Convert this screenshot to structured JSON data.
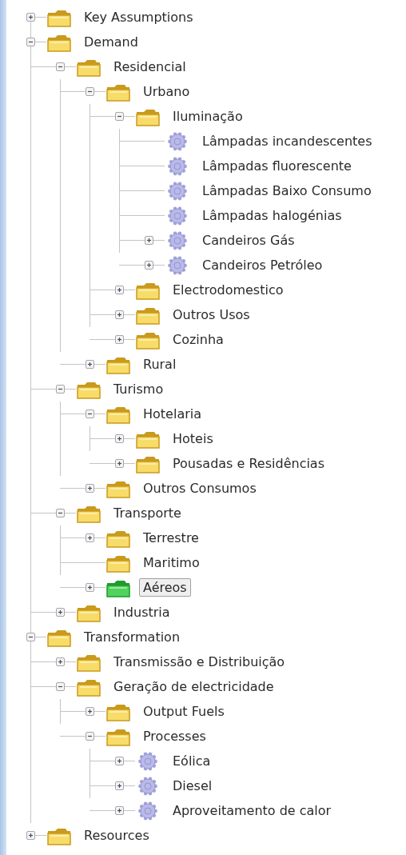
{
  "tree": [
    {
      "label": "Key Assumptions",
      "kind": "folder",
      "expanded": false,
      "selected": false
    },
    {
      "label": "Demand",
      "kind": "folder",
      "expanded": true,
      "selected": false,
      "children": [
        {
          "label": "Residencial",
          "kind": "folder",
          "expanded": true,
          "selected": false,
          "children": [
            {
              "label": "Urbano",
              "kind": "folder",
              "expanded": true,
              "selected": false,
              "children": [
                {
                  "label": "Iluminação",
                  "kind": "folder",
                  "expanded": true,
                  "selected": false,
                  "children": [
                    {
                      "label": "Lâmpadas incandescentes",
                      "kind": "gear",
                      "selected": false
                    },
                    {
                      "label": "Lâmpadas fluorescente",
                      "kind": "gear",
                      "selected": false
                    },
                    {
                      "label": "Lâmpadas Baixo Consumo",
                      "kind": "gear",
                      "selected": false
                    },
                    {
                      "label": "Lâmpadas halogénias",
                      "kind": "gear",
                      "selected": false
                    },
                    {
                      "label": "Candeiros Gás",
                      "kind": "gear",
                      "expanded": false,
                      "selected": false
                    },
                    {
                      "label": "Candeiros Petróleo",
                      "kind": "gear",
                      "expanded": false,
                      "selected": false
                    }
                  ]
                },
                {
                  "label": "Electrodomestico",
                  "kind": "folder",
                  "expanded": false,
                  "selected": false
                },
                {
                  "label": "Outros Usos",
                  "kind": "folder",
                  "expanded": false,
                  "selected": false
                },
                {
                  "label": "Cozinha",
                  "kind": "folder",
                  "expanded": false,
                  "selected": false
                }
              ]
            },
            {
              "label": "Rural",
              "kind": "folder",
              "expanded": false,
              "selected": false
            }
          ]
        },
        {
          "label": "Turismo",
          "kind": "folder",
          "expanded": true,
          "selected": false,
          "children": [
            {
              "label": "Hotelaria",
              "kind": "folder",
              "expanded": true,
              "selected": false,
              "children": [
                {
                  "label": "Hoteis",
                  "kind": "folder",
                  "expanded": false,
                  "selected": false
                },
                {
                  "label": "Pousadas e Residências",
                  "kind": "folder",
                  "expanded": false,
                  "selected": false
                }
              ]
            },
            {
              "label": "Outros Consumos",
              "kind": "folder",
              "expanded": false,
              "selected": false
            }
          ]
        },
        {
          "label": "Transporte",
          "kind": "folder",
          "expanded": true,
          "selected": false,
          "children": [
            {
              "label": "Terrestre",
              "kind": "folder",
              "expanded": false,
              "selected": false
            },
            {
              "label": "Maritimo",
              "kind": "folder",
              "selected": false
            },
            {
              "label": "Aéreos",
              "kind": "folder",
              "expanded": false,
              "selected": true
            }
          ]
        },
        {
          "label": "Industria",
          "kind": "folder",
          "expanded": false,
          "selected": false
        }
      ]
    },
    {
      "label": "Transformation",
      "kind": "folder",
      "expanded": true,
      "selected": false,
      "children": [
        {
          "label": "Transmissão e Distribuição",
          "kind": "folder",
          "expanded": false,
          "selected": false
        },
        {
          "label": "Geração de electricidade",
          "kind": "folder",
          "expanded": true,
          "selected": false,
          "children": [
            {
              "label": "Output Fuels",
              "kind": "folder",
              "expanded": false,
              "selected": false
            },
            {
              "label": "Processes",
              "kind": "folder",
              "expanded": true,
              "selected": false,
              "children": [
                {
                  "label": "Eólica",
                  "kind": "gear",
                  "expanded": false,
                  "selected": false
                },
                {
                  "label": "Diesel",
                  "kind": "gear",
                  "expanded": false,
                  "selected": false
                },
                {
                  "label": "Aproveitamento de calor",
                  "kind": "gear",
                  "expanded": false,
                  "selected": false
                }
              ]
            }
          ]
        }
      ]
    },
    {
      "label": "Resources",
      "kind": "folder",
      "expanded": false,
      "selected": false
    }
  ]
}
